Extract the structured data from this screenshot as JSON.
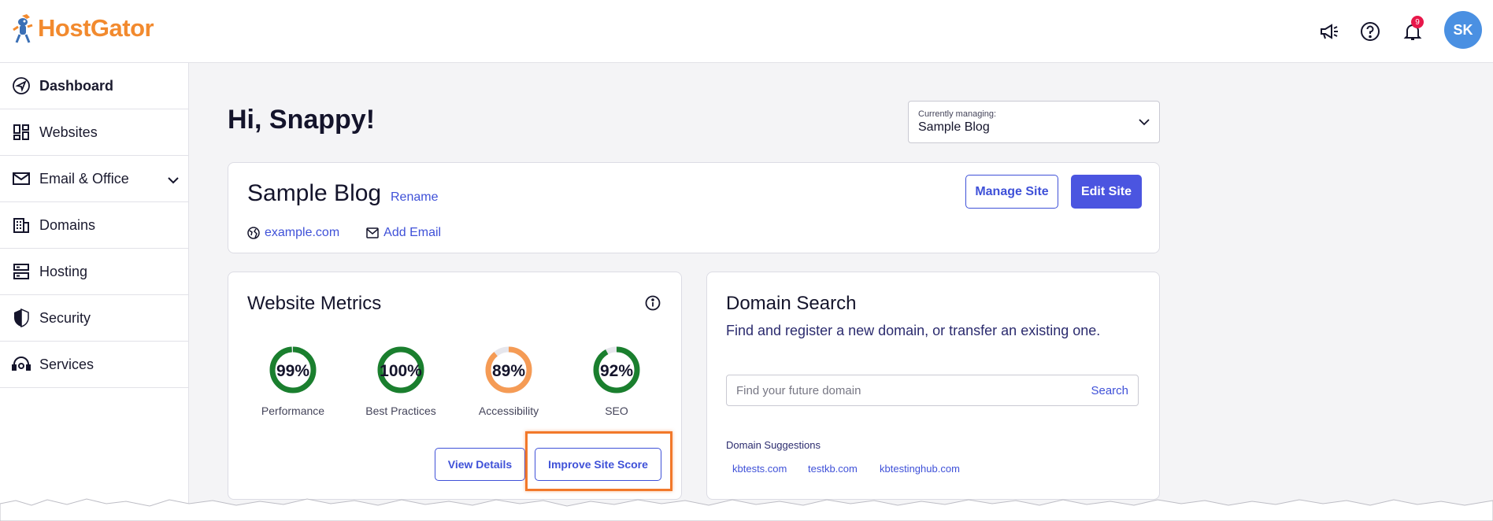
{
  "brand": {
    "name": "HostGator",
    "accent": "#f28a2e"
  },
  "header": {
    "notifications_count": "9",
    "avatar_initials": "SK",
    "icons": [
      "megaphone-icon",
      "help-icon",
      "bell-icon"
    ]
  },
  "sidebar": {
    "items": [
      {
        "label": "Dashboard",
        "icon": "navigation-icon",
        "active": true
      },
      {
        "label": "Websites",
        "icon": "grid-icon"
      },
      {
        "label": "Email & Office",
        "icon": "mail-icon",
        "expandable": true
      },
      {
        "label": "Domains",
        "icon": "building-icon"
      },
      {
        "label": "Hosting",
        "icon": "server-icon"
      },
      {
        "label": "Security",
        "icon": "shield-icon"
      },
      {
        "label": "Services",
        "icon": "support-icon"
      }
    ]
  },
  "main": {
    "greeting": "Hi, Snappy!",
    "managing": {
      "label": "Currently managing:",
      "value": "Sample Blog"
    }
  },
  "site_card": {
    "title": "Sample Blog",
    "rename": "Rename",
    "domain": "example.com",
    "add_email": "Add Email",
    "manage_button": "Manage Site",
    "edit_button": "Edit Site"
  },
  "metrics_card": {
    "title": "Website Metrics",
    "metrics": [
      {
        "label": "Performance",
        "value": "99%",
        "percent": 99,
        "color": "#1a7f2e"
      },
      {
        "label": "Best Practices",
        "value": "100%",
        "percent": 100,
        "color": "#1a7f2e"
      },
      {
        "label": "Accessibility",
        "value": "89%",
        "percent": 89,
        "color": "#f59b55"
      },
      {
        "label": "SEO",
        "value": "92%",
        "percent": 92,
        "color": "#1a7f2e"
      }
    ],
    "view_details": "View Details",
    "improve_score": "Improve Site Score"
  },
  "domain_card": {
    "title": "Domain Search",
    "subtitle": "Find and register a new domain, or transfer an existing one.",
    "search_placeholder": "Find your future domain",
    "search_button": "Search",
    "suggestions_heading": "Domain Suggestions",
    "suggestions": [
      "kbtests.com",
      "testkb.com",
      "kbtestinghub.com"
    ]
  }
}
